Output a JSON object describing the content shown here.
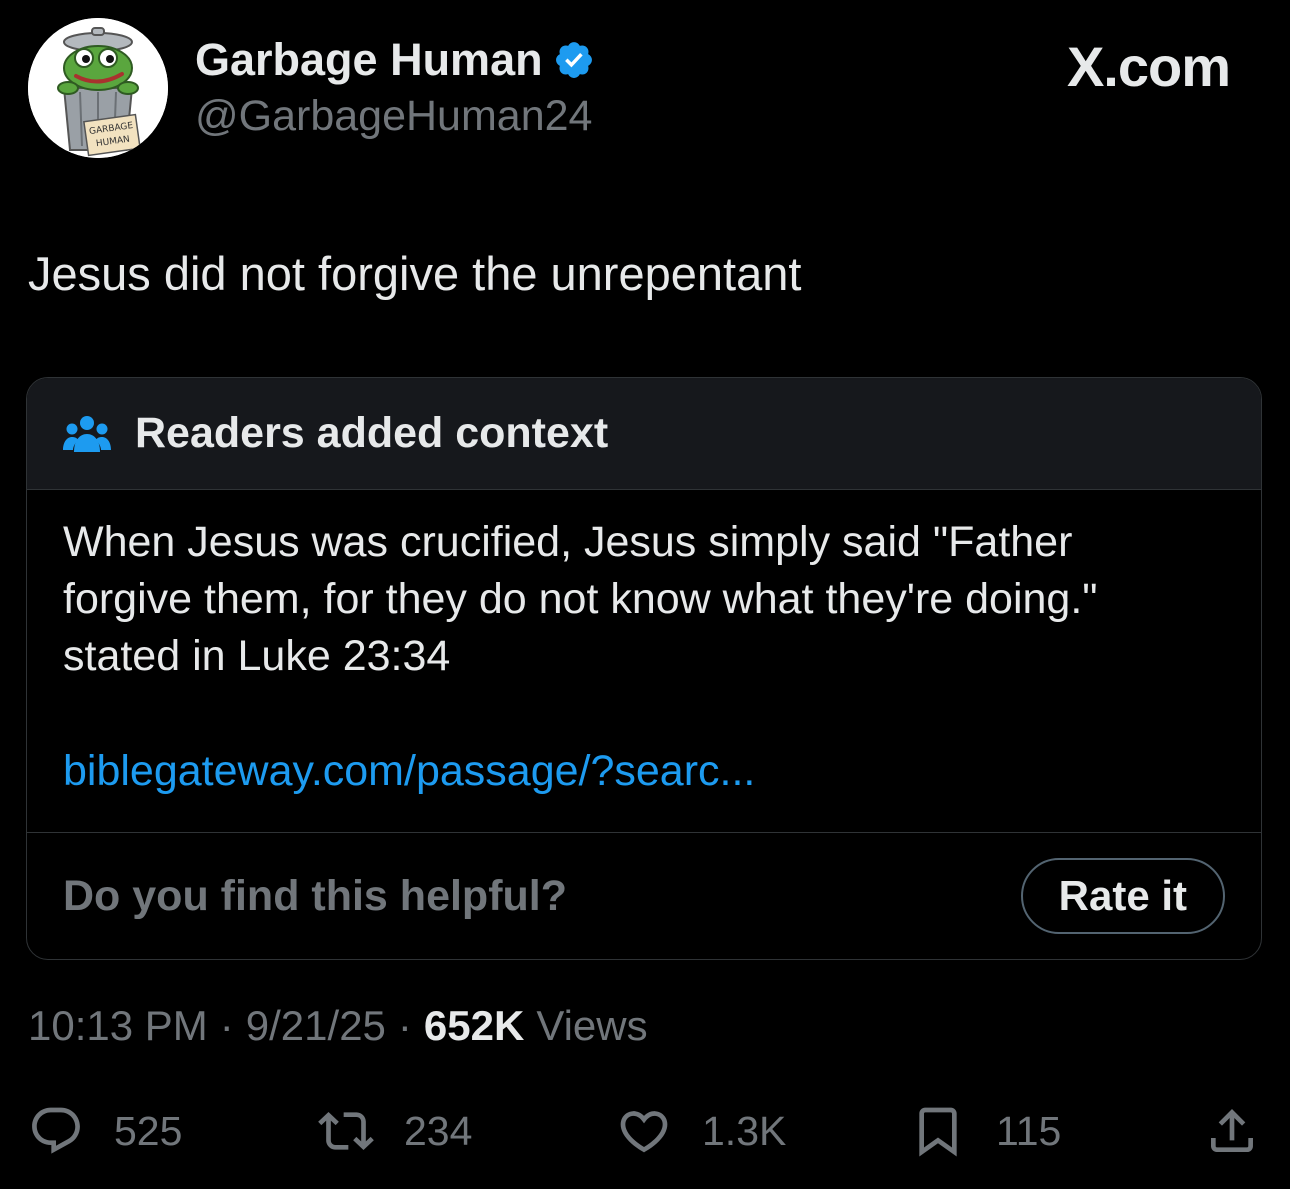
{
  "author": {
    "display_name": "Garbage Human",
    "handle": "@GarbageHuman24",
    "avatar_sign_line1": "GARBAGE",
    "avatar_sign_line2": "HUMAN"
  },
  "site": "X.com",
  "tweet": {
    "text": "Jesus did not forgive the unrepentant"
  },
  "community_note": {
    "title": "Readers added context",
    "body": "When Jesus was crucified, Jesus simply said \"Father\nforgive them, for they do not know what they're doing.\"\nstated in Luke 23:34",
    "link": "biblegateway.com/passage/?searc...",
    "helpful_prompt": "Do you find this helpful?",
    "rate_button": "Rate it"
  },
  "meta": {
    "time": "10:13 PM",
    "separator": "·",
    "date": "9/21/25",
    "views_count": "652K",
    "views_label": "Views"
  },
  "actions": {
    "replies": "525",
    "reposts": "234",
    "likes": "1.3K",
    "bookmarks": "115"
  },
  "icons": [
    "verified-badge-icon",
    "people-icon",
    "reply-icon",
    "repost-icon",
    "like-icon",
    "bookmark-icon",
    "share-icon"
  ],
  "colors": {
    "background": "#000000",
    "text_primary": "#e7e9ea",
    "text_secondary": "#71767b",
    "accent_blue": "#1d9bf0",
    "border": "#2f3336",
    "note_header_bg": "#16181c"
  }
}
